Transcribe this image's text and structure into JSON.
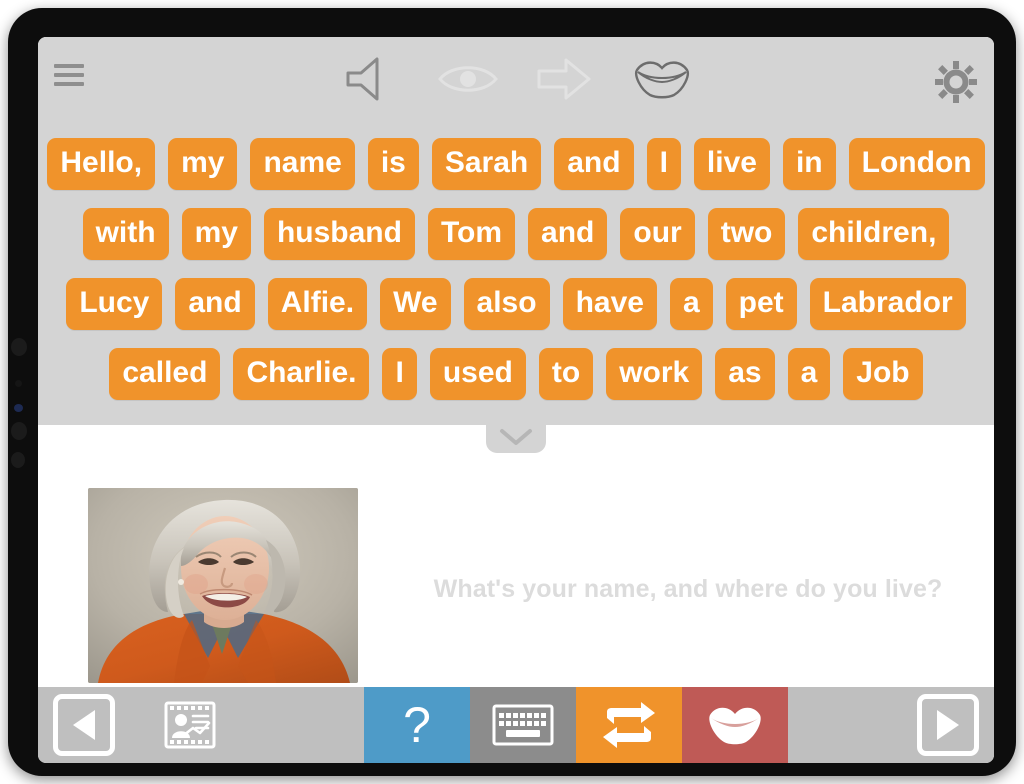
{
  "app": {
    "device": "tablet",
    "accent_orange": "#f0932b",
    "panel_gray": "#d4d4d4",
    "toolbar_gray": "#bfbfbf",
    "help_blue": "#4e9bc8",
    "speak_red": "#bf5a56"
  },
  "top_toolbar": {
    "menu": {
      "name": "hamburger-menu",
      "label": "Menu"
    },
    "actions": [
      {
        "name": "speaker-icon",
        "label": "Speaker",
        "state": "enabled"
      },
      {
        "name": "eye-icon",
        "label": "Eye",
        "state": "disabled"
      },
      {
        "name": "arrow-right-icon",
        "label": "Next",
        "state": "disabled"
      },
      {
        "name": "mouth-icon",
        "label": "Speak",
        "state": "enabled"
      }
    ],
    "settings": {
      "name": "gear-icon",
      "label": "Settings"
    }
  },
  "sentence": {
    "rows": [
      [
        "Hello,",
        "my",
        "name",
        "is",
        "Sarah",
        "and",
        "I",
        "live",
        "in",
        "London"
      ],
      [
        "with",
        "my",
        "husband",
        "Tom",
        "and",
        "our",
        "two",
        "children,"
      ],
      [
        "Lucy",
        "and",
        "Alfie.",
        "We",
        "also",
        "have",
        "a",
        "pet",
        "Labrador"
      ],
      [
        "called",
        "Charlie.",
        "I",
        "used",
        "to",
        "work",
        "as",
        "a",
        "Job"
      ]
    ],
    "collapse_handle": {
      "name": "chevron-down-icon",
      "label": "Collapse"
    }
  },
  "content": {
    "photo": {
      "name": "portrait-photo",
      "alt": "Smiling woman with grey hair wearing an orange jacket"
    },
    "prompt": "What's your name, and where do you live?"
  },
  "bottom_toolbar": {
    "back": {
      "name": "nav-back-button",
      "label": "Back"
    },
    "media_card": {
      "name": "media-card-button",
      "label": "Profile card"
    },
    "help": {
      "name": "help-button",
      "label": "?"
    },
    "keyboard": {
      "name": "keyboard-button",
      "label": "Keyboard"
    },
    "repeat": {
      "name": "repeat-button",
      "label": "Repeat"
    },
    "speak": {
      "name": "speak-button",
      "label": "Speak"
    },
    "forward": {
      "name": "nav-forward-button",
      "label": "Forward"
    }
  }
}
